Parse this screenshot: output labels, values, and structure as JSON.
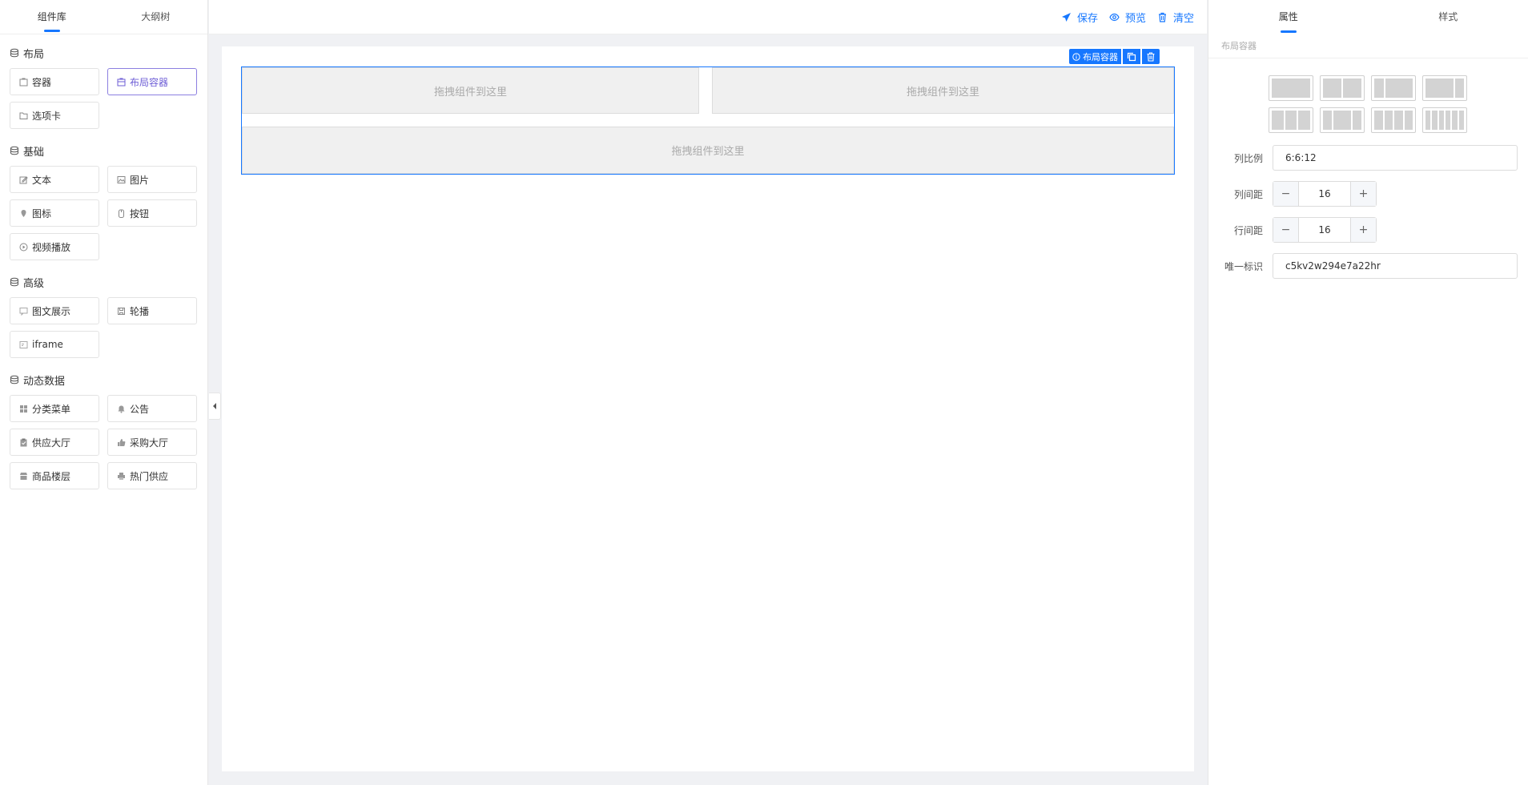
{
  "left_tabs": [
    {
      "label": "组件库"
    },
    {
      "label": "大纲树"
    }
  ],
  "groups": [
    {
      "title": "布局",
      "items": [
        {
          "label": "容器",
          "icon": "container-icon"
        },
        {
          "label": "布局容器",
          "icon": "layout-container-icon"
        },
        {
          "label": "选项卡",
          "icon": "folder-icon"
        }
      ]
    },
    {
      "title": "基础",
      "items": [
        {
          "label": "文本",
          "icon": "edit-icon"
        },
        {
          "label": "图片",
          "icon": "image-icon"
        },
        {
          "label": "图标",
          "icon": "pin-icon"
        },
        {
          "label": "按钮",
          "icon": "button-icon"
        },
        {
          "label": "视频播放",
          "icon": "play-circle-icon"
        }
      ]
    },
    {
      "title": "高级",
      "items": [
        {
          "label": "图文展示",
          "icon": "image-text-icon"
        },
        {
          "label": "轮播",
          "icon": "carousel-icon"
        },
        {
          "label": "iframe",
          "icon": "iframe-icon"
        }
      ]
    },
    {
      "title": "动态数据",
      "items": [
        {
          "label": "分类菜单",
          "icon": "grid-icon"
        },
        {
          "label": "公告",
          "icon": "bell-icon"
        },
        {
          "label": "供应大厅",
          "icon": "clipboard-icon"
        },
        {
          "label": "采购大厅",
          "icon": "thumb-up-icon"
        },
        {
          "label": "商品楼层",
          "icon": "shop-icon"
        },
        {
          "label": "热门供应",
          "icon": "print-icon"
        }
      ]
    }
  ],
  "toolbar": {
    "save": "保存",
    "preview": "预览",
    "clear": "清空"
  },
  "canvas": {
    "layout_label": "布局容器",
    "drop_text_1": "拖拽组件到这里",
    "drop_text_2": "拖拽组件到这里",
    "drop_text_3": "拖拽组件到这里"
  },
  "right_tabs": [
    {
      "label": "属性"
    },
    {
      "label": "样式"
    }
  ],
  "properties": {
    "section": "布局容器",
    "ratio_label": "列比例",
    "ratio_value": "6:6:12",
    "col_gap_label": "列间距",
    "col_gap_value": "16",
    "row_gap_label": "行间距",
    "row_gap_value": "16",
    "id_label": "唯一标识",
    "id_value": "c5kv2w294e7a22hr"
  },
  "colors": {
    "accent": "#1677ff",
    "selected": "#6e5ed6"
  }
}
